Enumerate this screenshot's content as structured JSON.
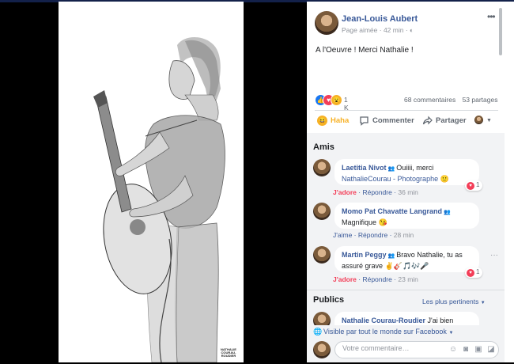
{
  "photo": {
    "credit": "NATHALIE COURAU-ROUDIER"
  },
  "post": {
    "author": "Jean-Louis Aubert",
    "meta_page": "Page aimée",
    "meta_time": "42 min",
    "text": "A l'Oeuvre ! Merci Nathalie !",
    "reaction_count": "1 K",
    "comments_count": "68 commentaires",
    "shares_count": "53 partages"
  },
  "actions": {
    "haha": "Haha",
    "comment": "Commenter",
    "share": "Partager"
  },
  "sections": {
    "friends": "Amis",
    "publics": "Publics",
    "sort": "Les plus pertinents"
  },
  "comments": [
    {
      "name": "Laetitia Nivot",
      "text": "Ouiiii, merci",
      "tag": "NathalieCourau - Photographe",
      "emoji": "🙂",
      "action": "J'adore",
      "reply": "Répondre",
      "time": "36 min",
      "hearts": "1"
    },
    {
      "name": "Momo Pat Chavatte Langrand",
      "text": "Magnifique",
      "emoji": "😘",
      "action": "J'aime",
      "reply": "Répondre",
      "time": "28 min"
    },
    {
      "name": "Martin Peggy",
      "text": "Bravo Nathalie, tu as assuré grave",
      "emoji": "✌🎸🎵🎶🎤",
      "action": "J'adore",
      "reply": "Répondre",
      "time": "23 min",
      "hearts": "1"
    },
    {
      "name": "Nathalie Courau-Roudier",
      "text": "J'ai bien"
    }
  ],
  "visibility": "Visible par tout le monde sur Facebook",
  "composer": {
    "placeholder": "Votre commentaire…"
  },
  "colors": {
    "link": "#385898",
    "love": "#f33e58",
    "haha": "#f7b125",
    "panel_bg": "#f2f3f5"
  }
}
